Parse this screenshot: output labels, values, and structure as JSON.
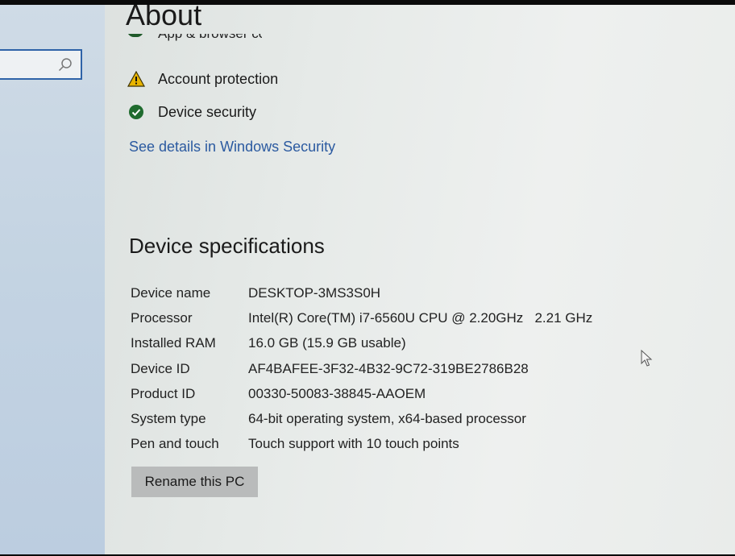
{
  "page": {
    "title": "About"
  },
  "search": {
    "placeholder": ""
  },
  "security": {
    "partial_item": "App & browser control",
    "items": [
      {
        "label": "Account protection",
        "status": "warning",
        "icon": "warning-icon"
      },
      {
        "label": "Device security",
        "status": "ok",
        "icon": "check-icon"
      }
    ],
    "link": "See details in Windows Security"
  },
  "device_specs": {
    "title": "Device specifications",
    "rows": [
      {
        "label": "Device name",
        "value": "DESKTOP-3MS3S0H"
      },
      {
        "label": "Processor",
        "value": "Intel(R) Core(TM) i7-6560U CPU @ 2.20GHz   2.21 GHz"
      },
      {
        "label": "Installed RAM",
        "value": "16.0 GB (15.9 GB usable)"
      },
      {
        "label": "Device ID",
        "value": "AF4BAFEE-3F32-4B32-9C72-319BE2786B28"
      },
      {
        "label": "Product ID",
        "value": "00330-50083-38845-AAOEM"
      },
      {
        "label": "System type",
        "value": "64-bit operating system, x64-based processor"
      },
      {
        "label": "Pen and touch",
        "value": "Touch support with 10 touch points"
      }
    ],
    "rename_button": "Rename this PC"
  },
  "colors": {
    "link": "#2b5aa0",
    "warning": "#e8b400",
    "ok": "#1f6b2e",
    "accent": "#2f63a8"
  }
}
